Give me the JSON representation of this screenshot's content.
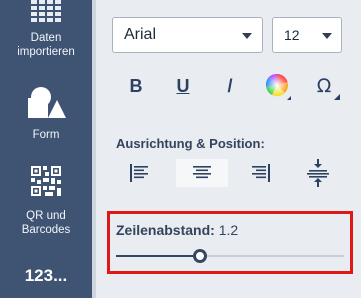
{
  "sidebar": {
    "items": [
      {
        "label": "Daten\nimportieren",
        "icon": "grid-table-icon"
      },
      {
        "label": "Form",
        "icon": "shapes-icon"
      },
      {
        "label": "QR und\nBarcodes",
        "icon": "qr-code-icon"
      },
      {
        "label": "123...",
        "icon": "numbering"
      }
    ]
  },
  "panel": {
    "font_select": {
      "value": "Arial"
    },
    "size_select": {
      "value": "12"
    },
    "format_buttons": {
      "bold": "B",
      "underline": "U",
      "italic": "/",
      "special_char": "Ω"
    },
    "alignment_title": "Ausrichtung & Position:",
    "line_spacing": {
      "label": "Zeilenabstand:",
      "value": "1.2",
      "slider_fraction": 0.37
    }
  },
  "colors": {
    "sidebar_bg": "#3f5372",
    "panel_bg": "#e9ecf0",
    "accent": "#35465f",
    "highlight": "#e01717"
  }
}
